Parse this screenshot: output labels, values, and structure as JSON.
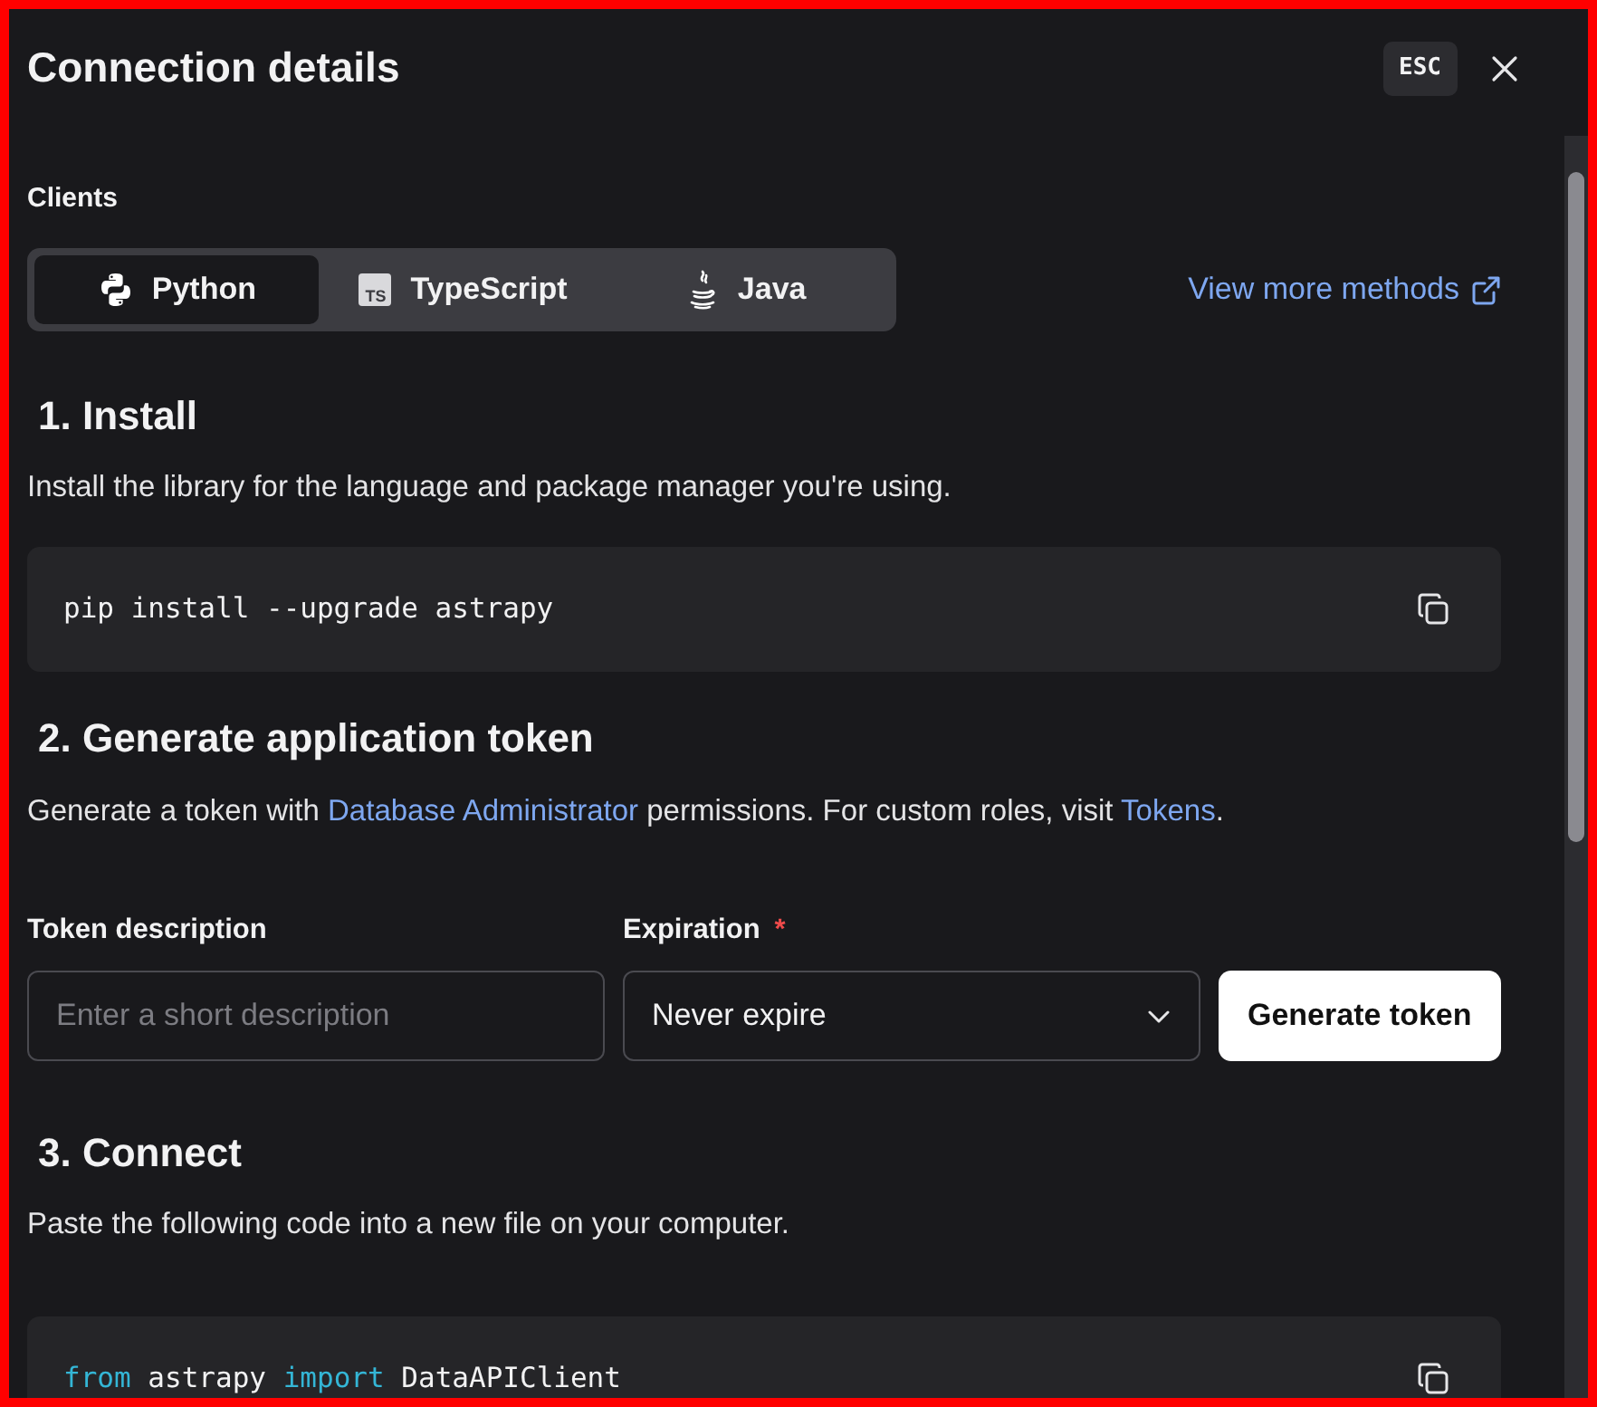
{
  "dialog": {
    "title": "Connection details",
    "esc_key": "ESC"
  },
  "clients": {
    "label": "Clients",
    "link": "View more methods",
    "tabs": [
      {
        "label": "Python",
        "kind": "python",
        "selected": true
      },
      {
        "label": "TypeScript",
        "kind": "typescript",
        "icon_text": "TS",
        "selected": false
      },
      {
        "label": "Java",
        "kind": "java",
        "selected": false
      }
    ]
  },
  "steps": [
    {
      "heading": "1. Install",
      "description": [
        {
          "text": "Install the library for the language and package manager you're using.",
          "link": false
        }
      ],
      "code": [
        [
          {
            "kind": "plain",
            "text": "pip install --upgrade astrapy"
          }
        ]
      ]
    },
    {
      "heading": "2. Generate application token",
      "description": [
        {
          "text": "Generate a token with ",
          "link": false
        },
        {
          "text": "Database Administrator",
          "link": true
        },
        {
          "text": " permissions. For custom roles, visit ",
          "link": false
        },
        {
          "text": "Tokens",
          "link": true
        },
        {
          "text": ".",
          "link": false
        }
      ],
      "form": {
        "description_label": "Token description",
        "description_placeholder": "Enter a short description",
        "expiration_label": "Expiration",
        "required_mark": "*",
        "expiration_value": "Never expire",
        "button": "Generate token"
      }
    },
    {
      "heading": "3. Connect",
      "description": [
        {
          "text": "Paste the following code into a new file on your computer.",
          "link": false
        }
      ],
      "code": [
        [
          {
            "kind": "keyword",
            "text": "from"
          },
          {
            "kind": "plain",
            "text": " astrapy "
          },
          {
            "kind": "keyword",
            "text": "import"
          },
          {
            "kind": "plain",
            "text": " DataAPIClient"
          }
        ]
      ]
    }
  ]
}
